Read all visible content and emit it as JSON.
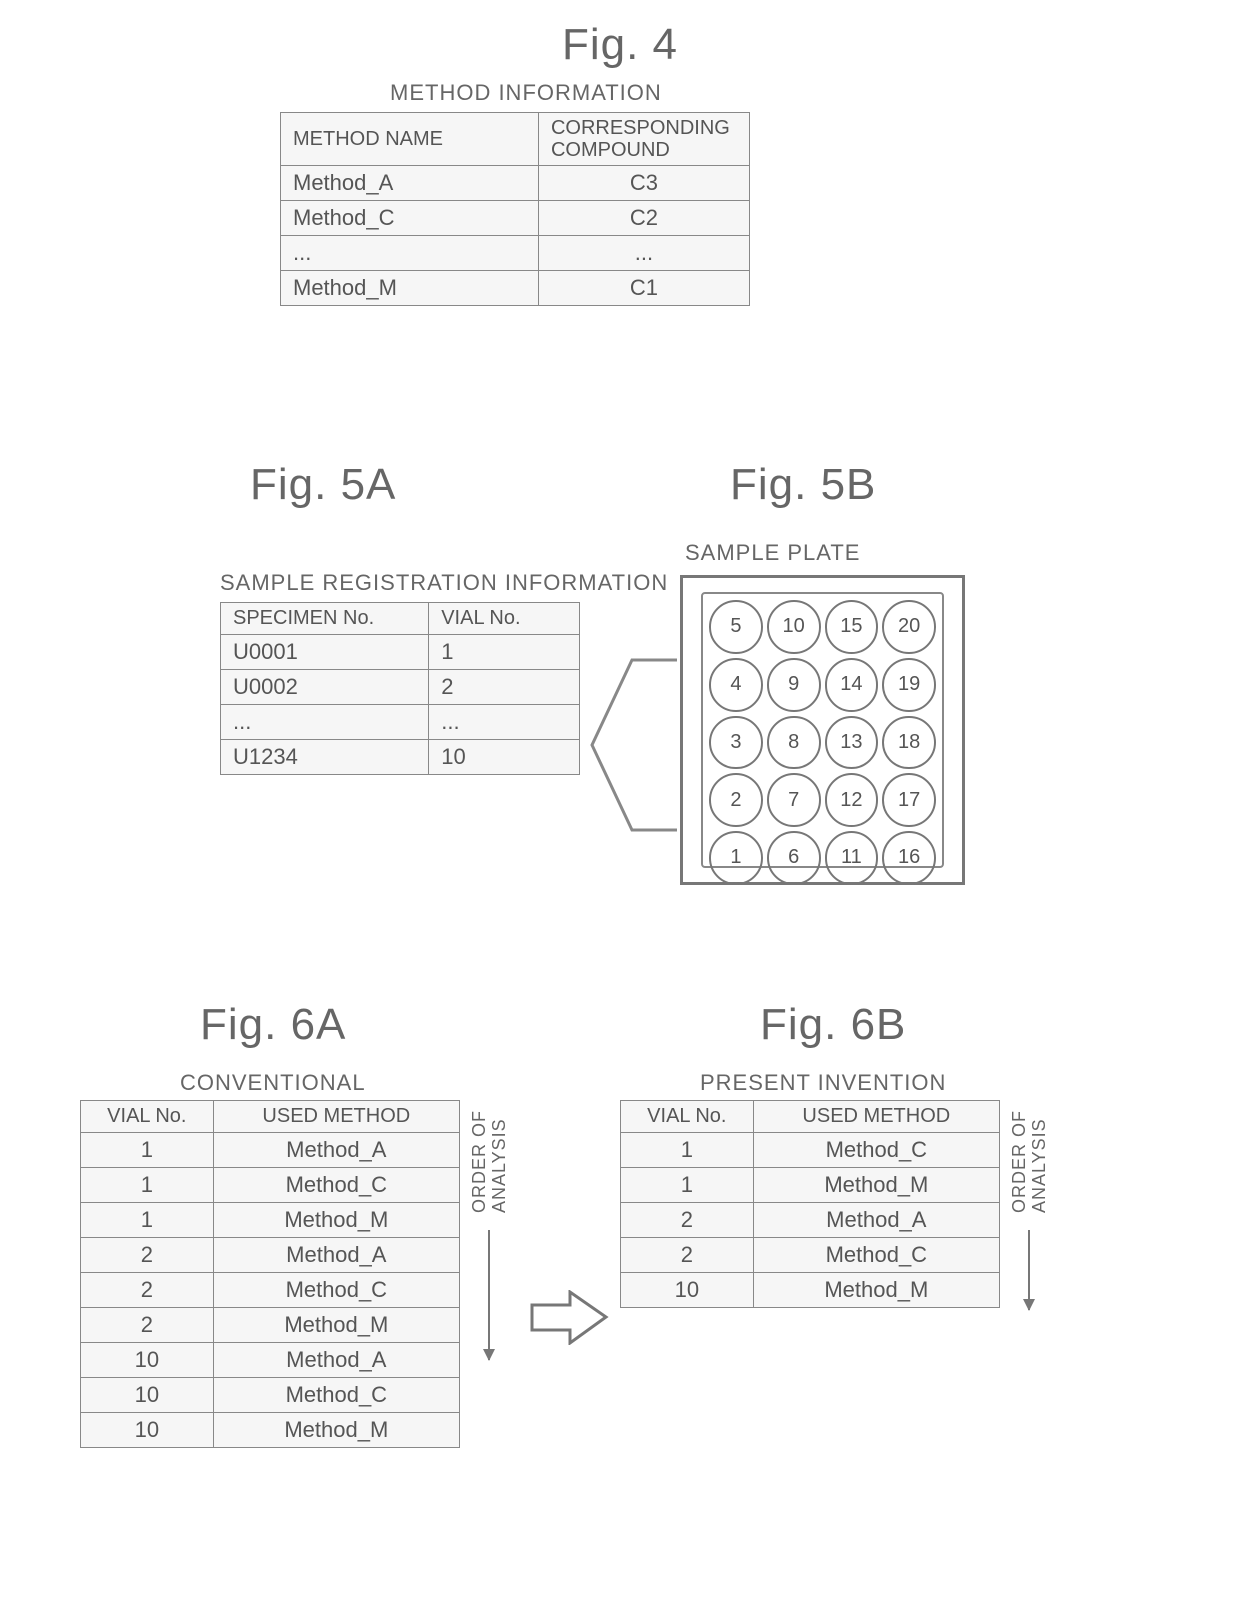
{
  "fig4": {
    "title": "Fig. 4",
    "caption": "METHOD INFORMATION",
    "headers": [
      "METHOD NAME",
      "CORRESPONDING COMPOUND"
    ],
    "rows": [
      [
        "Method_A",
        "C3"
      ],
      [
        "Method_C",
        "C2"
      ],
      [
        "...",
        "..."
      ],
      [
        "Method_M",
        "C1"
      ]
    ]
  },
  "fig5a": {
    "title": "Fig. 5A",
    "caption": "SAMPLE REGISTRATION INFORMATION",
    "headers": [
      "SPECIMEN No.",
      "VIAL No."
    ],
    "rows": [
      [
        "U0001",
        "1"
      ],
      [
        "U0002",
        "2"
      ],
      [
        "...",
        "..."
      ],
      [
        "U1234",
        "10"
      ]
    ]
  },
  "fig5b": {
    "title": "Fig. 5B",
    "caption": "SAMPLE PLATE",
    "plate_layout": [
      [
        5,
        10,
        15,
        20
      ],
      [
        4,
        9,
        14,
        19
      ],
      [
        3,
        8,
        13,
        18
      ],
      [
        2,
        7,
        12,
        17
      ],
      [
        1,
        6,
        11,
        16
      ]
    ]
  },
  "fig6a": {
    "title": "Fig. 6A",
    "caption": "CONVENTIONAL",
    "headers": [
      "VIAL No.",
      "USED METHOD"
    ],
    "rows": [
      [
        "1",
        "Method_A"
      ],
      [
        "1",
        "Method_C"
      ],
      [
        "1",
        "Method_M"
      ],
      [
        "2",
        "Method_A"
      ],
      [
        "2",
        "Method_C"
      ],
      [
        "2",
        "Method_M"
      ],
      [
        "10",
        "Method_A"
      ],
      [
        "10",
        "Method_C"
      ],
      [
        "10",
        "Method_M"
      ]
    ],
    "side_label": "ORDER OF\nANALYSIS"
  },
  "fig6b": {
    "title": "Fig. 6B",
    "caption": "PRESENT INVENTION",
    "headers": [
      "VIAL No.",
      "USED METHOD"
    ],
    "rows": [
      [
        "1",
        "Method_C"
      ],
      [
        "1",
        "Method_M"
      ],
      [
        "2",
        "Method_A"
      ],
      [
        "2",
        "Method_C"
      ],
      [
        "10",
        "Method_M"
      ]
    ],
    "side_label": "ORDER OF\nANALYSIS"
  }
}
